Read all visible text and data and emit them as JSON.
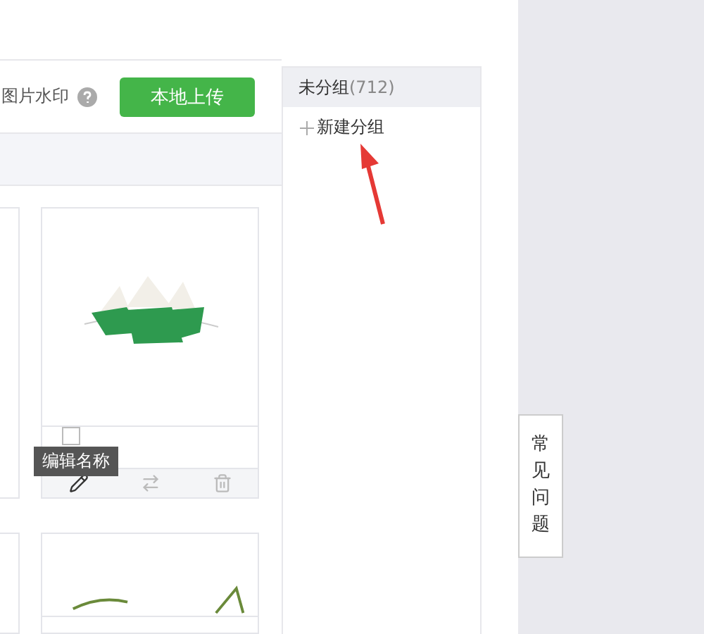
{
  "toolbar": {
    "watermark_label": "图片水印",
    "upload_button": "本地上传"
  },
  "groups": [
    {
      "label": "未分组",
      "count": "(712)",
      "selected": true
    }
  ],
  "new_group": {
    "label": "新建分组"
  },
  "cards": [
    {
      "kind": "food",
      "checked": false,
      "tooltip": "编辑名称"
    },
    {
      "kind": "grass"
    }
  ],
  "help_tab": "常见问题"
}
